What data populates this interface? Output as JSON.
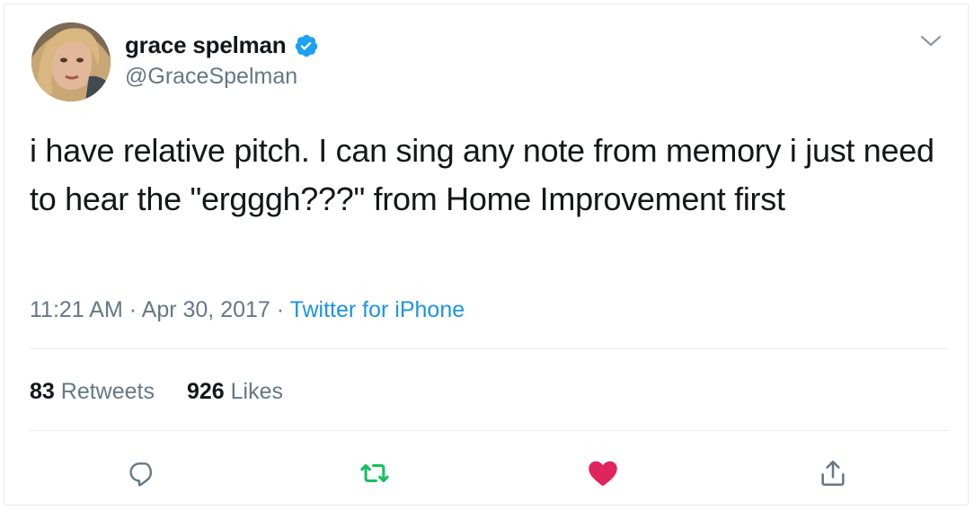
{
  "user": {
    "display_name": "grace spelman",
    "handle": "@GraceSpelman",
    "avatar_icon": "profile-photo",
    "verified_icon": "verified-badge-icon"
  },
  "tweet": {
    "text": "i have relative pitch. I can sing any note from memory i just need to hear the \"ergggh???\" from Home Improvement first",
    "time": "11:21 AM",
    "separator_1": "·",
    "date": "Apr 30, 2017",
    "separator_2": "·",
    "source": "Twitter for iPhone"
  },
  "stats": {
    "retweets_count": "83",
    "retweets_label": "Retweets",
    "likes_count": "926",
    "likes_label": "Likes"
  },
  "actions": {
    "reply_icon": "reply-icon",
    "retweet_icon": "retweet-icon",
    "like_icon": "heart-icon",
    "share_icon": "share-icon"
  },
  "colors": {
    "verified": "#1da1f2",
    "link": "#1b95e0",
    "retweet": "#17bf63",
    "like": "#e0245e",
    "muted": "#657786"
  }
}
